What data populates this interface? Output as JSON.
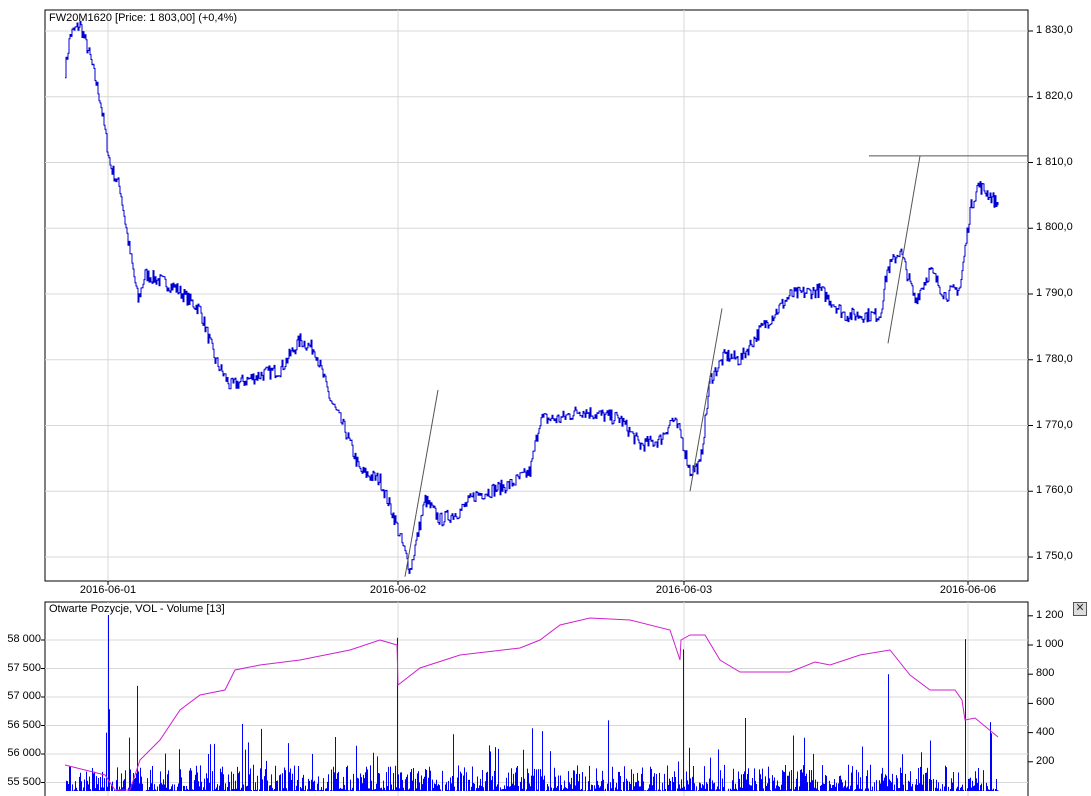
{
  "main_panel": {
    "title": "FW20M1620 [Price: 1 803,00] (+0,4%)",
    "y_ticks": [
      "1 750,0",
      "1 760,0",
      "1 770,0",
      "1 780,0",
      "1 790,0",
      "1 800,0",
      "1 810,0",
      "1 820,0",
      "1 830,0"
    ],
    "x_ticks": [
      "2016-06-01",
      "2016-06-02",
      "2016-06-03",
      "2016-06-06"
    ]
  },
  "lower_panel": {
    "title": "Otwarte Pozycje, VOL - Volume [13]",
    "left_ticks": [
      "55 500",
      "56 000",
      "56 500",
      "57 000",
      "57 500",
      "58 000"
    ],
    "right_ticks": [
      "200",
      "400",
      "600",
      "800",
      "1 000",
      "1 200"
    ],
    "close_label": "✕"
  },
  "colors": {
    "price": "#0000d0",
    "volume": "#0000ff",
    "open_interest": "#d020d0",
    "grid": "#d8d8d8",
    "trendline": "#555555"
  },
  "chart_data": [
    {
      "type": "line",
      "title": "FW20M1620",
      "ylabel": "Price",
      "ylim": [
        1746,
        1833
      ],
      "x_unit": "bar index",
      "xlim": [
        0,
        983
      ],
      "series": [
        {
          "name": "Price",
          "points": [
            [
              20,
              1824
            ],
            [
              25,
              1829.4
            ],
            [
              35,
              1831
            ],
            [
              45,
              1826
            ],
            [
              55,
              1819.5
            ],
            [
              65,
              1809.6
            ],
            [
              75,
              1806
            ],
            [
              83,
              1798
            ],
            [
              93,
              1789
            ],
            [
              100,
              1793
            ],
            [
              130,
              1791
            ],
            [
              155,
              1787.6
            ],
            [
              170,
              1780
            ],
            [
              185,
              1776
            ],
            [
              215,
              1777.7
            ],
            [
              235,
              1778.5
            ],
            [
              255,
              1783
            ],
            [
              270,
              1781.5
            ],
            [
              285,
              1774
            ],
            [
              300,
              1769.3
            ],
            [
              315,
              1763
            ],
            [
              335,
              1761.7
            ],
            [
              350,
              1755.6
            ],
            [
              365,
              1748
            ],
            [
              380,
              1758.7
            ],
            [
              395,
              1755.6
            ],
            [
              415,
              1757
            ],
            [
              430,
              1759.4
            ],
            [
              465,
              1761
            ],
            [
              485,
              1763
            ],
            [
              495,
              1771
            ],
            [
              515,
              1771
            ],
            [
              535,
              1772.3
            ],
            [
              555,
              1771.6
            ],
            [
              575,
              1771
            ],
            [
              595,
              1767
            ],
            [
              615,
              1767.8
            ],
            [
              627,
              1771
            ],
            [
              635,
              1769
            ],
            [
              645,
              1763
            ],
            [
              655,
              1764
            ],
            [
              665,
              1777
            ],
            [
              680,
              1780.7
            ],
            [
              695,
              1780
            ],
            [
              715,
              1784.5
            ],
            [
              745,
              1789.8
            ],
            [
              775,
              1790.6
            ],
            [
              800,
              1786.8
            ],
            [
              835,
              1786.8
            ],
            [
              842,
              1793.6
            ],
            [
              855,
              1796.7
            ],
            [
              870,
              1789
            ],
            [
              885,
              1793.6
            ],
            [
              900,
              1789.8
            ],
            [
              915,
              1791
            ],
            [
              925,
              1802.8
            ],
            [
              933,
              1806.6
            ],
            [
              945,
              1805
            ],
            [
              953,
              1803.5
            ]
          ]
        }
      ],
      "trendlines": [
        [
          [
            360,
            1747
          ],
          [
            393,
            1775.4
          ]
        ],
        [
          [
            645,
            1760
          ],
          [
            677,
            1787.8
          ]
        ],
        [
          [
            843,
            1782.5
          ],
          [
            875,
            1811
          ]
        ],
        [
          [
            824,
            1811
          ],
          [
            983,
            1811
          ]
        ]
      ],
      "x_ticks": [
        {
          "x": 63,
          "label": "2016-06-01"
        },
        {
          "x": 353,
          "label": "2016-06-02"
        },
        {
          "x": 639,
          "label": "2016-06-03"
        },
        {
          "x": 923,
          "label": "2016-06-06"
        }
      ]
    },
    {
      "type": "bar",
      "title": "Otwarte Pozycje, VOL - Volume [13]",
      "left_ylim": [
        55330,
        58480
      ],
      "right_ylim": [
        0,
        1260
      ],
      "volume_spikes": [
        [
          63,
          1300
        ],
        [
          92,
          720
        ],
        [
          64,
          560
        ],
        [
          352,
          1050
        ],
        [
          638,
          970
        ],
        [
          843,
          800
        ],
        [
          920,
          1040
        ],
        [
          700,
          500
        ],
        [
          487,
          430
        ],
        [
          497,
          410
        ],
        [
          290,
          370
        ],
        [
          165,
          320
        ],
        [
          748,
          380
        ]
      ],
      "volume_baseline": 90,
      "open_interest": [
        [
          20,
          55807
        ],
        [
          40,
          55720
        ],
        [
          60,
          55632
        ],
        [
          70,
          55369
        ],
        [
          85,
          55369
        ],
        [
          95,
          55895
        ],
        [
          115,
          56246
        ],
        [
          135,
          56772
        ],
        [
          155,
          57035
        ],
        [
          180,
          57123
        ],
        [
          190,
          57474
        ],
        [
          215,
          57561
        ],
        [
          255,
          57649
        ],
        [
          305,
          57825
        ],
        [
          335,
          58000
        ],
        [
          352,
          57912
        ],
        [
          353,
          57211
        ],
        [
          375,
          57509
        ],
        [
          415,
          57737
        ],
        [
          475,
          57860
        ],
        [
          495,
          58000
        ],
        [
          515,
          58263
        ],
        [
          545,
          58386
        ],
        [
          585,
          58351
        ],
        [
          625,
          58175
        ],
        [
          635,
          57650
        ],
        [
          636,
          58000
        ],
        [
          645,
          58088
        ],
        [
          660,
          58088
        ],
        [
          675,
          57649
        ],
        [
          695,
          57439
        ],
        [
          745,
          57439
        ],
        [
          770,
          57614
        ],
        [
          785,
          57561
        ],
        [
          815,
          57737
        ],
        [
          845,
          57825
        ],
        [
          865,
          57386
        ],
        [
          885,
          57123
        ],
        [
          910,
          57123
        ],
        [
          917,
          56948
        ],
        [
          920,
          56597
        ],
        [
          930,
          56632
        ],
        [
          953,
          56299
        ]
      ]
    }
  ]
}
